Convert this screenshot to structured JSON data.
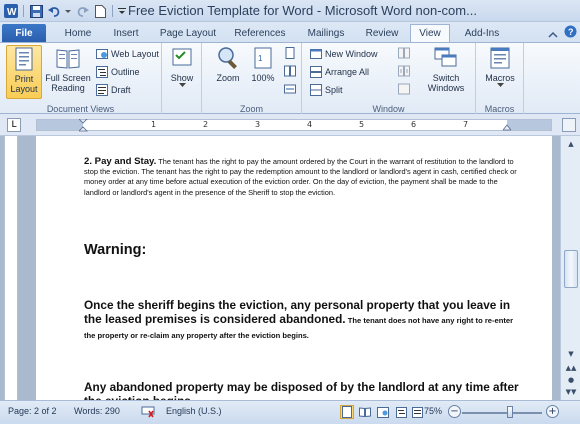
{
  "window": {
    "title": "Free Eviction Template for Word  -  Microsoft Word non-com..."
  },
  "tabs": [
    {
      "label": "File"
    },
    {
      "label": "Home"
    },
    {
      "label": "Insert"
    },
    {
      "label": "Page Layout"
    },
    {
      "label": "References"
    },
    {
      "label": "Mailings"
    },
    {
      "label": "Review"
    },
    {
      "label": "View"
    },
    {
      "label": "Add-Ins"
    }
  ],
  "active_tab": "View",
  "ribbon": {
    "document_views": {
      "label": "Document Views",
      "print_layout": "Print\nLayout",
      "full_screen_reading": "Full Screen\nReading",
      "web_layout": "Web Layout",
      "outline": "Outline",
      "draft": "Draft"
    },
    "zoom": {
      "label": "Zoom",
      "show": "Show",
      "zoom": "Zoom",
      "hundred": "100%"
    },
    "window": {
      "label": "Window",
      "new_window": "New Window",
      "arrange_all": "Arrange All",
      "split": "Split",
      "switch_windows": "Switch\nWindows"
    },
    "macros": {
      "label": "Macros",
      "macros": "Macros"
    }
  },
  "ruler": {
    "tab_selector": "L",
    "numbers": [
      "1",
      "2",
      "3",
      "4",
      "5",
      "6",
      "7"
    ]
  },
  "document": {
    "para1_heading": "2. Pay and Stay.",
    "para1_body": " The tenant has the right to pay the amount ordered by the Court in the warrant of restitution to the landlord to stop the eviction. The tenant has the right to pay the redemption amount to the landlord or landlord's agent in cash, certified check or money order at any time before actual execution of the eviction order. On the day of eviction, the payment shall be made to the landlord or landlord's agent in the presence of the Sheriff to stop the eviction.",
    "warning": "Warning:",
    "para2_main": "Once the sheriff begins the eviction, any personal property that you leave in the leased premises is considered abandoned.",
    "para2_small": " The tenant does not have any right to re-enter the property or re-claim any property after the eviction begins.",
    "para3": "Any abandoned property may be disposed of by the landlord at any time after the eviction begins."
  },
  "status": {
    "page": "Page: 2 of 2",
    "words": "Words: 290",
    "language": "English (U.S.)",
    "zoom": "75%",
    "zoom_minus": "−",
    "zoom_plus": "+",
    "zoom_fraction": 0.6
  },
  "colors": {
    "file_tab": "#2a5fad",
    "selected_button": "#f9cd55",
    "ribbon_bg": "#e1eaf6"
  }
}
